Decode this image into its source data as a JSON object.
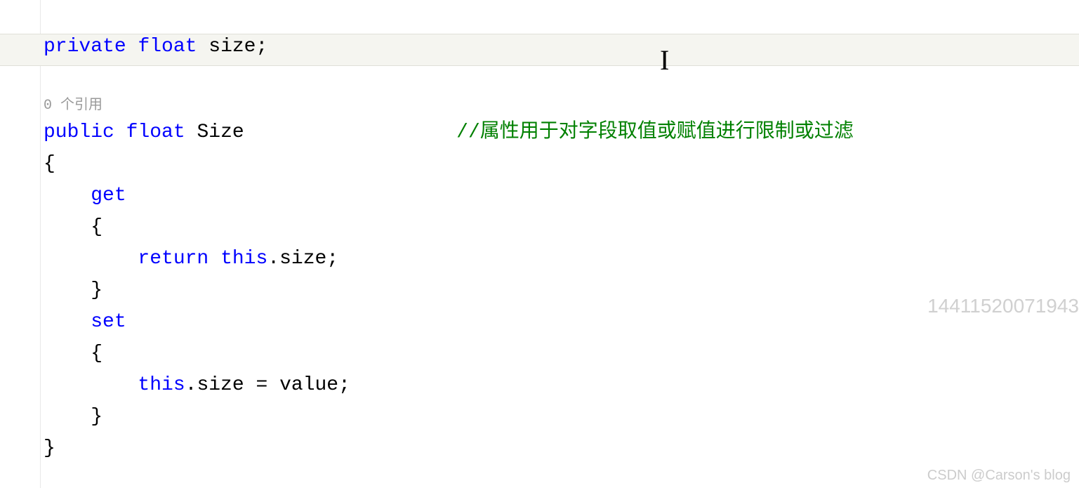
{
  "code": {
    "line1": {
      "kw_private": "private",
      "kw_float": "float",
      "ident": "size",
      "semi": ";"
    },
    "codelens": "0 个引用",
    "line3": {
      "kw_public": "public",
      "kw_float": "float",
      "ident": "Size",
      "comment": "//属性用于对字段取值或赋值进行限制或过滤"
    },
    "brace_open": "{",
    "get": {
      "kw": "get",
      "brace_open": "{",
      "kw_return": "return",
      "kw_this": "this",
      "dot": ".",
      "ident": "size",
      "semi": ";",
      "brace_close": "}"
    },
    "set": {
      "kw": "set",
      "brace_open": "{",
      "kw_this": "this",
      "dot1": ".",
      "ident_size": "size",
      "eq": " = ",
      "ident_value": "value",
      "semi": ";",
      "brace_close": "}"
    },
    "brace_close": "}"
  },
  "cursor_glyph": "I",
  "watermark_number": "14411520071943",
  "watermark_csdn": "CSDN @Carson's  blog"
}
